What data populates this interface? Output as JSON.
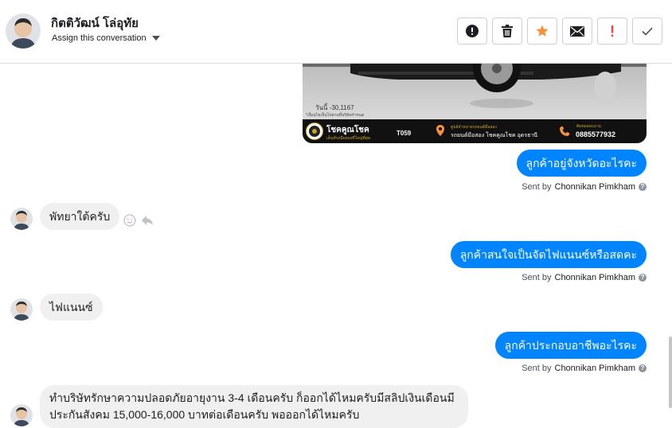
{
  "header": {
    "contact_name": "กิตติวัฒน์ โล่อุทัย",
    "assign_label": "Assign this conversation",
    "actions": [
      {
        "icon": "alert-circle-icon",
        "color": "#1c1e21"
      },
      {
        "icon": "trash-icon",
        "color": "#1c1e21"
      },
      {
        "icon": "star-icon",
        "color": "#f7923b"
      },
      {
        "icon": "envelope-icon",
        "color": "#1c1e21"
      },
      {
        "icon": "exclamation-icon",
        "color": "#fa3e3e"
      },
      {
        "icon": "checkmark-icon",
        "color": "#4b4f56"
      }
    ]
  },
  "image_message": {
    "price_text": "วันนี้ -30,1167",
    "price_sub": "*เงื่อนไขเป็นไปตามที่บริษัทกำหนด",
    "brand": "โชคคูณโชค",
    "brand_sub": "เต็นท์รถมือสองที่ใหญ่ที่สุด",
    "code": "T059",
    "location_top": "ศูนย์จำหน่ายรถยนต์มือสอง",
    "location": "รถยนต์มือสอง โชคคูณโชค อุดรธานี",
    "phone_top": "ติดต่อสอบถาม",
    "phone": "0885577932"
  },
  "messages": [
    {
      "dir": "out",
      "text": "ลูกค้าอยู่จังหวัดอะไรคะ",
      "sent_by_prefix": "Sent by",
      "sent_by_name": "Chonnikan Pimkham"
    },
    {
      "dir": "in",
      "text": "พัทยาใต้ครับ"
    },
    {
      "dir": "out",
      "text": "ลูกค้าสนใจเป็นจัดไฟแนนซ์หรือสดคะ",
      "sent_by_prefix": "Sent by",
      "sent_by_name": "Chonnikan Pimkham"
    },
    {
      "dir": "in",
      "text": "ไฟแนนซ์"
    },
    {
      "dir": "out",
      "text": "ลูกค้าประกอบอาชีพอะไรคะ",
      "sent_by_prefix": "Sent by",
      "sent_by_name": "Chonnikan Pimkham"
    },
    {
      "dir": "in",
      "text": "ทำบริษัทรักษาความปลอดภัยอายุงาน 3-4 เดือนครับ ก็ออกได้ไหมครับมีสลิปเงินเดือนมี ประกันสังคม 15,000-16,000 บาทต่อเดือนครับ พอออกได้ไหมครับ"
    }
  ],
  "colors": {
    "outgoing_bubble": "#0084ff",
    "incoming_bubble": "#f1f0f0"
  }
}
